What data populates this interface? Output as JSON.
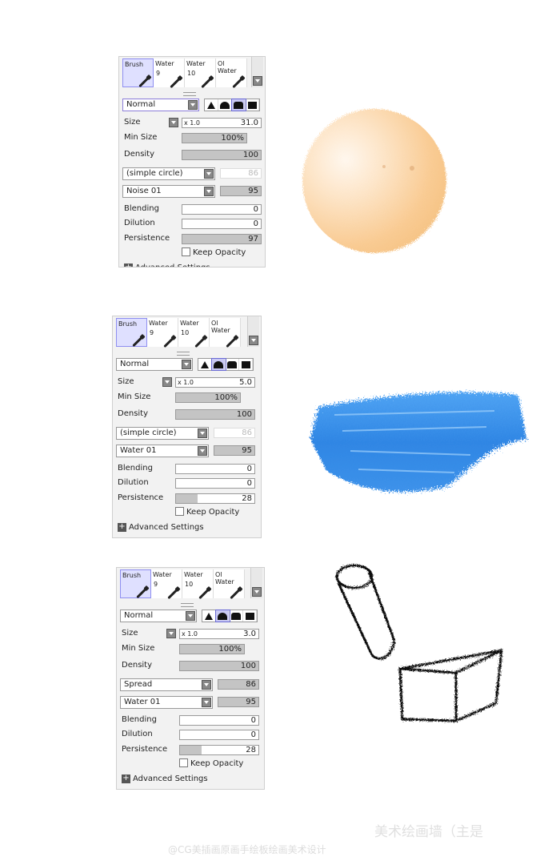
{
  "panels": [
    {
      "tools": [
        {
          "label": "Brush",
          "number": "",
          "active": true
        },
        {
          "label": "Water",
          "number": "9",
          "active": false
        },
        {
          "label": "Water",
          "number": "10",
          "active": false
        },
        {
          "label": "Ol Water",
          "number": "",
          "active": false
        }
      ],
      "mode": "Normal",
      "selected_shape": 2,
      "size_mult": "x 1.0",
      "size": "31.0",
      "min_size": "100%",
      "density": "100",
      "shape_select": "(simple circle)",
      "shape_value": "86",
      "shape_value_enabled": false,
      "texture_select": "Noise 01",
      "texture_value": "95",
      "blending": "0",
      "dilution": "0",
      "persistence": "97",
      "persistence_fraction": 1.0,
      "keep_opacity": "Keep Opacity",
      "advanced": "Advanced Settings",
      "labels": {
        "size": "Size",
        "min_size": "Min Size",
        "density": "Density",
        "blending": "Blending",
        "dilution": "Dilution",
        "persistence": "Persistence"
      }
    },
    {
      "tools": [
        {
          "label": "Brush",
          "number": "",
          "active": true
        },
        {
          "label": "Water",
          "number": "9",
          "active": false
        },
        {
          "label": "Water",
          "number": "10",
          "active": false
        },
        {
          "label": "Ol Water",
          "number": "",
          "active": false
        }
      ],
      "mode": "Normal",
      "selected_shape": 1,
      "size_mult": "x 1.0",
      "size": "5.0",
      "min_size": "100%",
      "density": "100",
      "shape_select": "(simple circle)",
      "shape_value": "86",
      "shape_value_enabled": false,
      "texture_select": "Water 01",
      "texture_value": "95",
      "blending": "0",
      "dilution": "0",
      "persistence": "28",
      "persistence_fraction": 0.28,
      "keep_opacity": "Keep Opacity",
      "advanced": "Advanced Settings",
      "labels": {
        "size": "Size",
        "min_size": "Min Size",
        "density": "Density",
        "blending": "Blending",
        "dilution": "Dilution",
        "persistence": "Persistence"
      }
    },
    {
      "tools": [
        {
          "label": "Brush",
          "number": "",
          "active": true
        },
        {
          "label": "Water",
          "number": "9",
          "active": false
        },
        {
          "label": "Water",
          "number": "10",
          "active": false
        },
        {
          "label": "Ol Water",
          "number": "",
          "active": false
        }
      ],
      "mode": "Normal",
      "selected_shape": 1,
      "size_mult": "x 1.0",
      "size": "3.0",
      "min_size": "100%",
      "density": "100",
      "shape_select": "Spread",
      "shape_value": "86",
      "shape_value_enabled": true,
      "texture_select": "Water 01",
      "texture_value": "95",
      "blending": "0",
      "dilution": "0",
      "persistence": "28",
      "persistence_fraction": 0.28,
      "keep_opacity": "Keep Opacity",
      "advanced": "Advanced Settings",
      "labels": {
        "size": "Size",
        "min_size": "Min Size",
        "density": "Density",
        "blending": "Blending",
        "dilution": "Dilution",
        "persistence": "Persistence"
      }
    }
  ],
  "watermark": {
    "main": "美术绘画墙（主是",
    "sub": "@CG美插画原画手绘板绘画美术设计"
  },
  "colors": {
    "panel_bg": "#f2f2f2",
    "active_tool": "#dfe0ff",
    "slider_fill": "#c4c4c4",
    "orange_ball": "#fbd3a4",
    "blue_stroke": "#2f86e4"
  }
}
